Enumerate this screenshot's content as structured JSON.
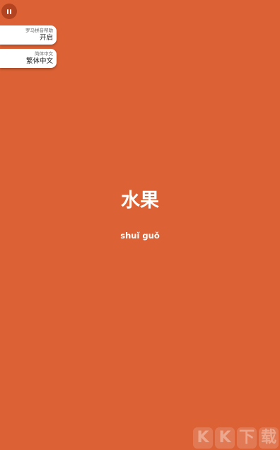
{
  "settings": {
    "pinyin": {
      "label": "罗马拼音帮助",
      "value": "开启"
    },
    "script": {
      "label": "简体中文",
      "value": "繁体中文"
    }
  },
  "flashcard": {
    "word": "水果",
    "pinyin": "shuǐ guǒ"
  },
  "watermark": {
    "text": [
      "K",
      "K",
      "下",
      "载"
    ]
  },
  "colors": {
    "background": "#DC6134",
    "pause_button": "#B24421",
    "card": "#FFFFFF"
  },
  "icons": {
    "pause": "pause-icon"
  }
}
